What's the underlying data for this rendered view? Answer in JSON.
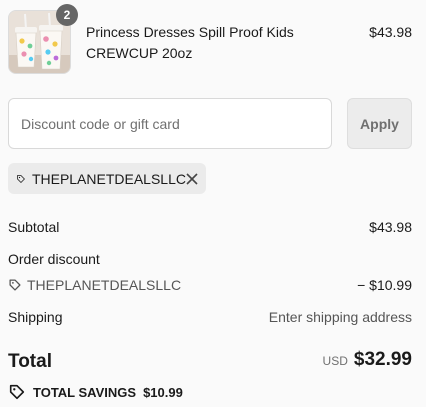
{
  "product": {
    "quantity": "2",
    "title": "Princess Dresses Spill Proof Kids CREWCUP 20oz",
    "price": "$43.98",
    "thumbnail_icon": "tumbler-image"
  },
  "discount": {
    "placeholder": "Discount code or gift card",
    "value": "",
    "apply_label": "Apply",
    "applied_code": "THEPLANETDEALSLLC"
  },
  "summary": {
    "subtotal_label": "Subtotal",
    "subtotal_value": "$43.98",
    "order_discount_label": "Order discount",
    "discount_code": "THEPLANETDEALSLLC",
    "discount_value": "− $10.99",
    "shipping_label": "Shipping",
    "shipping_value": "Enter shipping address",
    "total_label": "Total",
    "currency": "USD",
    "total_value": "$32.99",
    "savings_label": "TOTAL SAVINGS",
    "savings_value": "$10.99"
  },
  "colors": {
    "badge": "#666666",
    "chip_bg": "#ebebeb",
    "apply_bg": "#ececec",
    "text": "#1a1a1a",
    "muted": "#707070"
  }
}
